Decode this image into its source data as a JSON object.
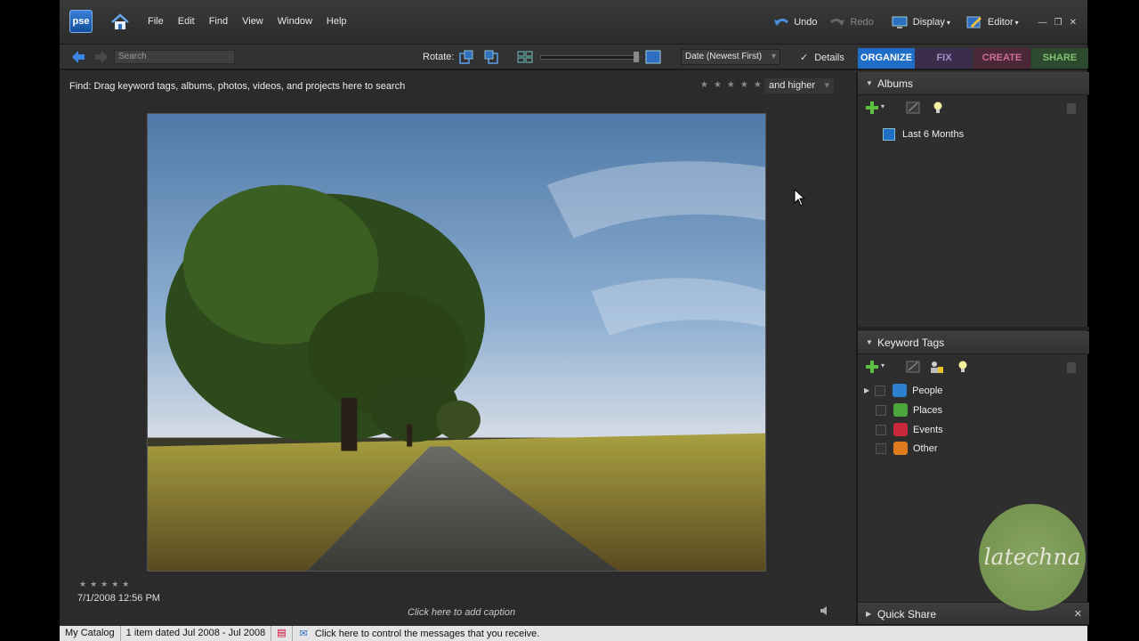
{
  "app": {
    "logo": "pse"
  },
  "menu": {
    "items": [
      "File",
      "Edit",
      "Find",
      "View",
      "Window",
      "Help"
    ]
  },
  "topbar": {
    "undo": "Undo",
    "redo": "Redo",
    "display": "Display",
    "editor": "Editor"
  },
  "toolbar": {
    "search_placeholder": "Search",
    "rotate_label": "Rotate:",
    "sort_value": "Date (Newest First)",
    "details_label": "Details"
  },
  "tabs": [
    {
      "label": "ORGANIZE",
      "color": "#1e6dc6"
    },
    {
      "label": "FIX",
      "color": "#3a2e4c"
    },
    {
      "label": "CREATE",
      "color": "#4a2838"
    },
    {
      "label": "SHARE",
      "color": "#2e4a2e"
    }
  ],
  "findbar": {
    "text": "Find: Drag keyword tags, albums, photos, videos, and projects here to search",
    "rating_filter": "and higher"
  },
  "media": {
    "date": "7/1/2008 12:56 PM",
    "caption_prompt": "Click here to add caption"
  },
  "albums": {
    "title": "Albums",
    "items": [
      {
        "label": "Last 6 Months"
      }
    ]
  },
  "keyword_tags": {
    "title": "Keyword Tags",
    "items": [
      {
        "label": "People",
        "color": "#2d7fd0"
      },
      {
        "label": "Places",
        "color": "#4aa83a"
      },
      {
        "label": "Events",
        "color": "#c8283a"
      },
      {
        "label": "Other",
        "color": "#e07a20"
      }
    ]
  },
  "quick_share": {
    "title": "Quick Share"
  },
  "watermark": {
    "text": "latechna"
  },
  "statusbar": {
    "catalog": "My Catalog",
    "items_info": "1 item dated Jul 2008 - Jul 2008",
    "message": "Click here to control the messages that you receive."
  }
}
